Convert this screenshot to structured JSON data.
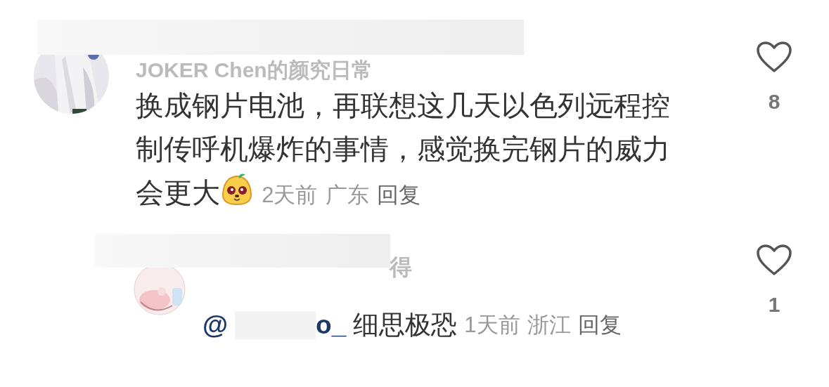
{
  "comments": [
    {
      "username": "JOKER Chen的颜究日常",
      "text_lines": [
        "换成钢片电池，再联想这几天以色列远程控",
        "制传呼机爆炸的事情，感觉换完钢片的威力",
        "会更大"
      ],
      "has_emoji": true,
      "time": "2天前",
      "location": "广东",
      "reply_label": "回复",
      "likes": "8",
      "liked": false,
      "replies": [
        {
          "username": "得",
          "mention_start": "@",
          "mention_end": "o_",
          "text": "细思极恐",
          "time": "1天前",
          "location": "浙江",
          "reply_label": "回复",
          "likes": "1",
          "liked": false
        }
      ]
    }
  ]
}
